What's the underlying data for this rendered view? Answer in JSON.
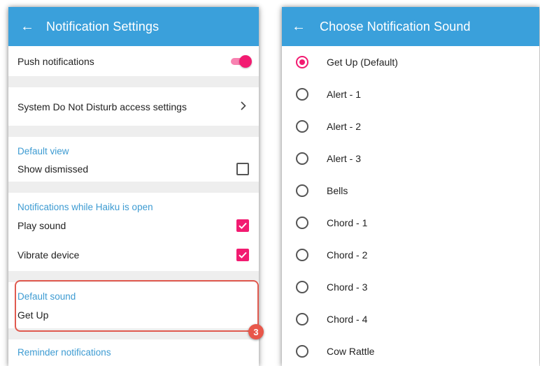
{
  "colors": {
    "appbar": "#3aa0db",
    "accent": "#f21b71",
    "section_header": "#3d9bd2",
    "badge": "#e8574a"
  },
  "settings_screen": {
    "back_icon": "arrow-left-icon",
    "title": "Notification Settings",
    "push_notifications": {
      "label": "Push notifications",
      "enabled": true
    },
    "dnd_access": {
      "label": "System Do Not Disturb access settings",
      "icon": "chevron-right-icon"
    },
    "default_view": {
      "header": "Default view",
      "show_dismissed": {
        "label": "Show dismissed",
        "checked": false
      }
    },
    "while_open": {
      "header": "Notifications while Haiku is open",
      "play_sound": {
        "label": "Play sound",
        "checked": true
      },
      "vibrate_device": {
        "label": "Vibrate device",
        "checked": true
      }
    },
    "default_sound": {
      "header": "Default sound",
      "value": "Get Up"
    },
    "reminder": {
      "header": "Reminder notifications"
    },
    "step_badge": "3"
  },
  "sound_screen": {
    "back_icon": "arrow-left-icon",
    "title": "Choose Notification Sound",
    "selected_index": 0,
    "options": [
      "Get Up (Default)",
      "Alert - 1",
      "Alert - 2",
      "Alert - 3",
      "Bells",
      "Chord - 1",
      "Chord - 2",
      "Chord - 3",
      "Chord - 4",
      "Cow Rattle"
    ]
  }
}
